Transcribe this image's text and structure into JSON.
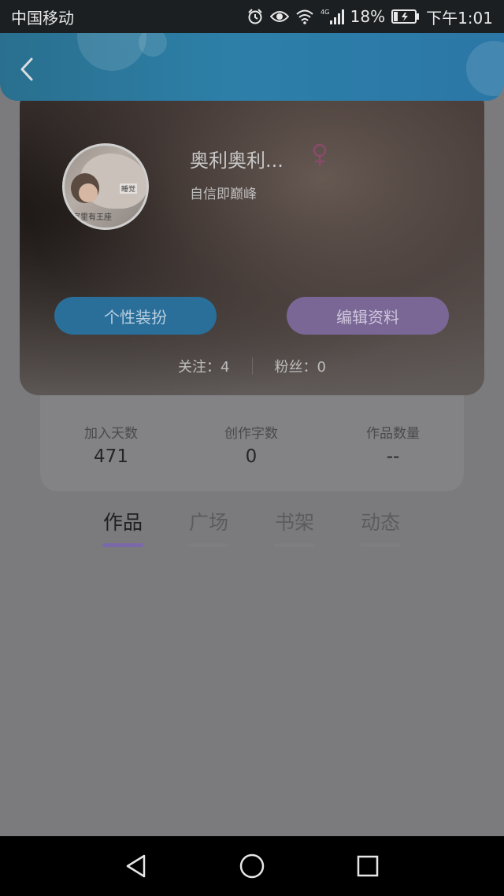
{
  "status_bar": {
    "carrier": "中国移动",
    "network": "4G",
    "battery": "18%",
    "time": "下午1:01"
  },
  "profile": {
    "username": "奥利奥利...",
    "signature": "自信即巅峰",
    "gender_color": "#8a4a6a",
    "avatar_caption": "家里有王座",
    "avatar_tag": "睡觉",
    "dress_button": "个性装扮",
    "edit_button": "编辑资料",
    "following": "关注：4",
    "followers": "粉丝：0"
  },
  "stats": [
    {
      "label": "加入天数",
      "value": "471"
    },
    {
      "label": "创作字数",
      "value": "0"
    },
    {
      "label": "作品数量",
      "value": "--"
    }
  ],
  "tabs": [
    {
      "label": "作品",
      "active": true
    },
    {
      "label": "广场",
      "active": false
    },
    {
      "label": "书架",
      "active": false
    },
    {
      "label": "动态",
      "active": false
    }
  ],
  "colors": {
    "tab_underline_active": "#7a68a8",
    "tab_underline_inactive": "#7e7e80"
  }
}
